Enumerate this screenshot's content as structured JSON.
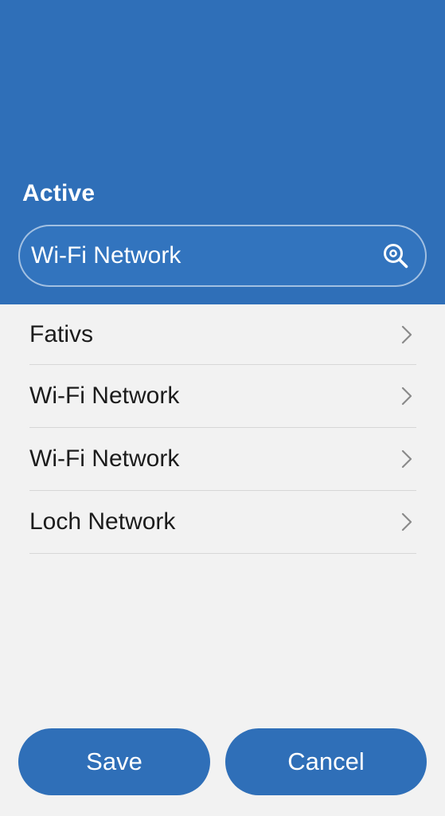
{
  "header": {
    "title": "Active",
    "background_color": "#2f6fb8"
  },
  "search": {
    "value": "Wi-Fi Network",
    "icon": "search-icon"
  },
  "networks": [
    {
      "label": "Fativs",
      "icon": "chevron-right-icon"
    },
    {
      "label": "Wi-Fi Network",
      "icon": "chevron-right-icon"
    },
    {
      "label": "Wi-Fi Network",
      "icon": "chevron-right-icon"
    },
    {
      "label": "Loch Network",
      "icon": "chevron-right-icon"
    }
  ],
  "actions": {
    "save_label": "Save",
    "cancel_label": "Cancel",
    "button_color": "#2f6fb8"
  }
}
